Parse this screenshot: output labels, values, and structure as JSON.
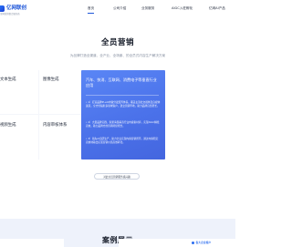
{
  "header": {
    "logo_text": "亿网联创",
    "logo_subtitle": "全网营销整合服务商",
    "nav": [
      {
        "label": "首页",
        "active": true
      },
      {
        "label": "公司介绍",
        "active": false
      },
      {
        "label": "业务服务",
        "active": false
      },
      {
        "label": "AIGC入驻孵化",
        "active": false
      },
      {
        "label": "亿网AI产品",
        "active": false
      }
    ]
  },
  "marketing": {
    "title": "全员营销",
    "subtitle": "为品牌打造全渠道、全产业、全场景、的全员式内容生产解决方案",
    "services": [
      {
        "label": "文本生成"
      },
      {
        "label": "图像生成"
      },
      {
        "label": "视频生成"
      },
      {
        "label": "内容审核体系"
      }
    ],
    "feature": {
      "title": "汽车、快消、互联网、消费电子等垂直行业应用",
      "items": [
        "• 1）打造品牌IP+AI内容分发矩阵体系，覆盖主流社交媒体及自媒体渠道，全方位辐射多领域客户，建立营销阵地，助力品牌自然增长。",
        "• 2）大量品牌实践，积累海量垂直行业内容素材库，实现AIGC精准高效，助力品牌方的营销持续增长。",
        "• 3）领先AI自研生产，助力企业实现内容营销闭环，通过内容稳定高效地输出实现营销价值高效转化。"
      ]
    },
    "consult_label": "对此全员营销服务感兴趣"
  },
  "cases": {
    "title": "案例展示",
    "badge_text": "各大企业客户"
  },
  "colors": {
    "brand": "#1e56d9",
    "feature_card": "#4b72ea",
    "section_bg": "#eef2fb"
  }
}
